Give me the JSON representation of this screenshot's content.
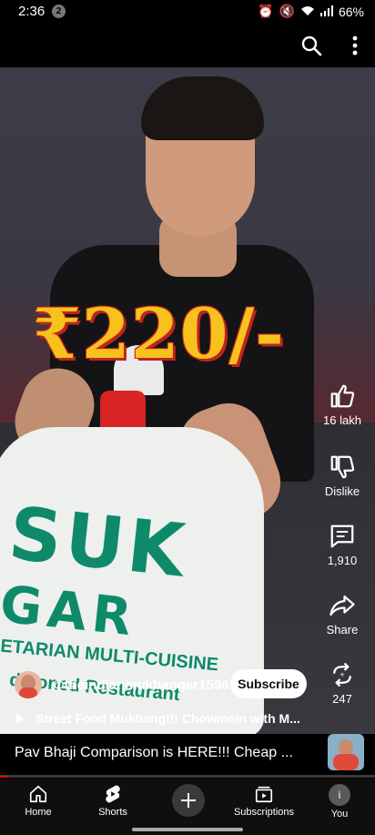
{
  "status_bar": {
    "time": "2:36",
    "notification_count": "2",
    "battery": "66%"
  },
  "overlay": {
    "price_text": "₹220/-"
  },
  "actions": {
    "like_count": "16 lakh",
    "dislike_label": "Dislike",
    "comment_count": "1,910",
    "share_label": "Share",
    "remix_count": "247"
  },
  "channel": {
    "handle": "@theindianmukbanger1596",
    "subscribe_label": "Subscribe"
  },
  "video": {
    "title": "Street Food Mukbang!!! Chowmein with M..."
  },
  "bag_print": {
    "line1": "SUK",
    "line2": "GAR",
    "line3": "ETARIAN MULTI-CUISINE",
    "line4": "ditioned Restaurant"
  },
  "next_up": {
    "title": "Pav Bhaji Comparison is HERE!!! Cheap  ..."
  },
  "playback": {
    "progress_percent": 2
  },
  "nav": {
    "home": "Home",
    "shorts": "Shorts",
    "subscriptions": "Subscriptions",
    "you": "You",
    "you_initial": "i"
  }
}
